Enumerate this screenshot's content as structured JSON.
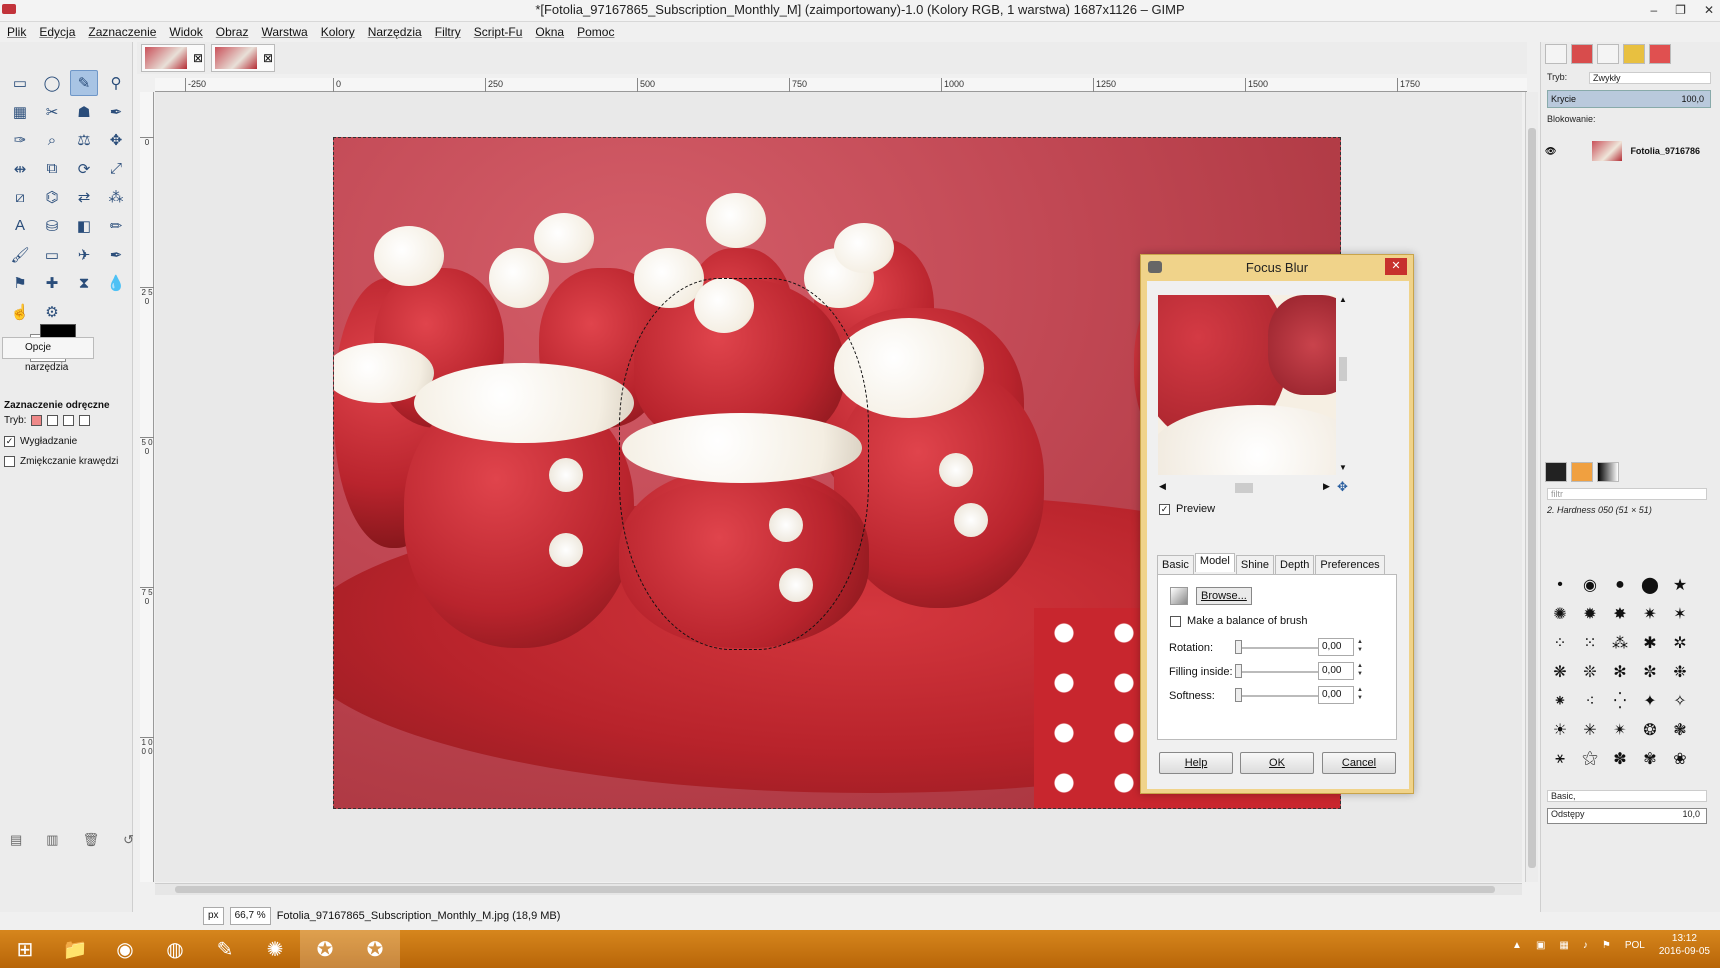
{
  "window": {
    "title": "*[Fotolia_97167865_Subscription_Monthly_M] (zaimportowany)-1.0 (Kolory RGB, 1 warstwa) 1687x1126 – GIMP",
    "controls": [
      "–",
      "❐",
      "✕"
    ]
  },
  "menu": [
    "Plik",
    "Edycja",
    "Zaznaczenie",
    "Widok",
    "Obraz",
    "Warstwa",
    "Kolory",
    "Narzędzia",
    "Filtry",
    "Script-Fu",
    "Okna",
    "Pomoc"
  ],
  "toolbox": {
    "icons": [
      "rect-select-icon",
      "ellipse-select-icon",
      "free-select-icon",
      "fuzzy-select-icon",
      "color-select-icon",
      "scissors-icon",
      "foreground-select-icon",
      "paths-icon",
      "color-picker-icon",
      "zoom-icon",
      "measure-icon",
      "move-icon",
      "align-icon",
      "crop-icon",
      "rotate-icon",
      "scale-icon",
      "shear-icon",
      "perspective-icon",
      "flip-icon",
      "cage-icon",
      "text-icon",
      "bucket-fill-icon",
      "blend-icon",
      "pencil-icon",
      "paintbrush-icon",
      "eraser-icon",
      "airbrush-icon",
      "ink-icon",
      "clone-icon",
      "heal-icon",
      "perspective-clone-icon",
      "blur-icon",
      "smudge-icon",
      "dodge-icon"
    ],
    "glyphs": [
      "▭",
      "◯",
      "✎",
      "⚲",
      "▦",
      "✂",
      "☗",
      "✒",
      "✑",
      "⌕",
      "⚖",
      "✥",
      "⇹",
      "⧉",
      "⟳",
      "⤢",
      "⧄",
      "⌬",
      "⇄",
      "⁂",
      "A",
      "⛁",
      "◧",
      "✏",
      "🖌",
      "▭",
      "✈",
      "✒",
      "⚑",
      "✚",
      "⧗",
      "💧",
      "☝",
      "⚙"
    ],
    "active_index": 2,
    "options_tab": "Opcje narzędzia",
    "options_title": "Zaznaczenie odręczne",
    "mode_label": "Tryb:",
    "antialias_label": "Wygładzanie",
    "feather_label": "Zmiękczanie krawędzi"
  },
  "ruler": {
    "h_labels": [
      "-250",
      "0",
      "250",
      "500",
      "750",
      "1000",
      "1250",
      "1500",
      "1750"
    ],
    "v_labels": [
      "0",
      "2 5 0",
      "5 0 0",
      "7 5 0",
      "1 0 0 0"
    ]
  },
  "status": {
    "unit": "px",
    "zoom": "66,7 %",
    "message": "Fotolia_97167865_Subscription_Monthly_M.jpg (18,9 MB)"
  },
  "layers": {
    "mode_label": "Tryb:",
    "mode_value": "Zwykły",
    "opacity_label": "Krycie",
    "opacity_value": "100,0",
    "lock_label": "Blokowanie:",
    "layer_name": "Fotolia_9716786"
  },
  "brushes": {
    "filter_placeholder": "filtr",
    "current": "2. Hardness 050 (51 × 51)",
    "preset": "Basic,",
    "spacing_label": "Odstępy",
    "spacing_value": "10,0"
  },
  "dialog": {
    "title": "Focus Blur",
    "preview_label": "Preview",
    "tabs": [
      "Basic",
      "Model",
      "Shine",
      "Depth",
      "Preferences"
    ],
    "active_tab": 1,
    "browse_label": "Browse...",
    "balance_label": "Make a balance of brush",
    "rotation_label": "Rotation:",
    "rotation_value": "0,00",
    "filling_label": "Filling inside:",
    "filling_value": "0,00",
    "softness_label": "Softness:",
    "softness_value": "0,00",
    "help_label": "Help",
    "ok_label": "OK",
    "cancel_label": "Cancel"
  },
  "taskbar": {
    "language": "POL",
    "time": "13:12",
    "date": "2016-09-05"
  },
  "colors": {
    "taskbar": "#c9760f",
    "dialog_frame": "#f0d38a",
    "close_red": "#c7312d"
  }
}
